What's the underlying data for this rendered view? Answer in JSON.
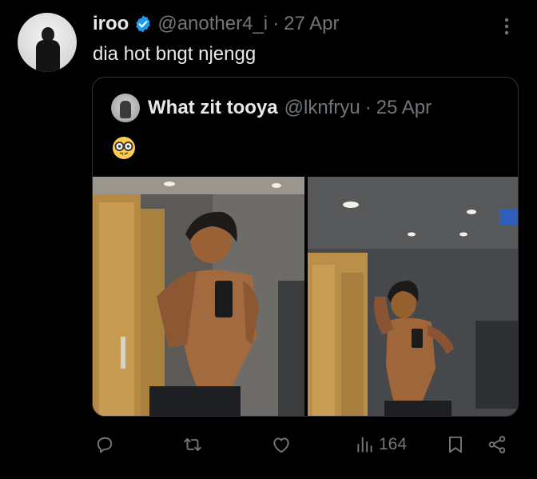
{
  "tweet": {
    "author_name": "iroo",
    "author_handle": "@another4_i",
    "separator": "·",
    "date": "27 Apr",
    "text": "dia hot bngt njengg"
  },
  "quoted_tweet": {
    "author_name": "What zit tooya",
    "author_handle": "@lknfryu",
    "separator": "·",
    "date": "25 Apr",
    "emoji_icon": "nerd-face-emoji"
  },
  "actions": {
    "views_count": "164"
  },
  "colors": {
    "background": "#000000",
    "text_primary": "#e7e9ea",
    "text_secondary": "#71767b",
    "verified_blue": "#1d9bf0",
    "border": "#2f3336"
  },
  "icons": [
    "verified-badge-icon",
    "more-options-icon",
    "reply-icon",
    "retweet-icon",
    "like-icon",
    "views-icon",
    "bookmark-icon",
    "share-icon"
  ]
}
